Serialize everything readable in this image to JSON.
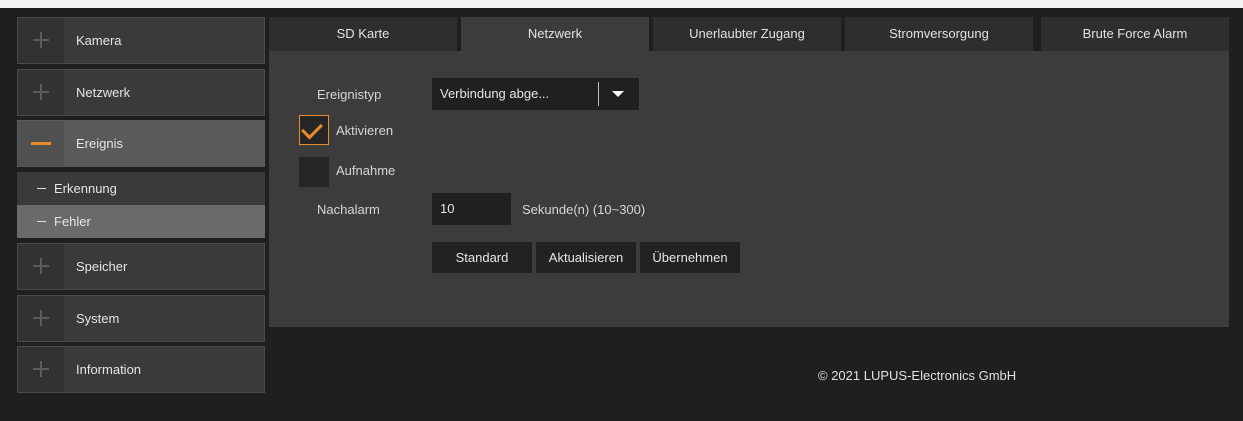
{
  "sidebar": {
    "items": [
      {
        "label": "Kamera",
        "icon": "plus-icon"
      },
      {
        "label": "Netzwerk",
        "icon": "plus-icon"
      },
      {
        "label": "Ereignis",
        "icon": "minus-icon",
        "expanded": true
      },
      {
        "label": "Speicher",
        "icon": "plus-icon"
      },
      {
        "label": "System",
        "icon": "plus-icon"
      },
      {
        "label": "Information",
        "icon": "plus-icon"
      }
    ],
    "subitems": [
      {
        "label": "Erkennung",
        "selected": false
      },
      {
        "label": "Fehler",
        "selected": true
      }
    ]
  },
  "tabs": [
    {
      "label": "SD Karte",
      "active": false
    },
    {
      "label": "Netzwerk",
      "active": true
    },
    {
      "label": "Unerlaubter Zugang",
      "active": false
    },
    {
      "label": "Stromversorgung",
      "active": false
    },
    {
      "label": "Brute Force Alarm",
      "active": false
    }
  ],
  "form": {
    "event_type_label": "Ereignistyp",
    "event_type_value": "Verbindung abge...",
    "enable_label": "Aktivieren",
    "enable_checked": true,
    "record_label": "Aufnahme",
    "record_checked": false,
    "post_alarm_label": "Nachalarm",
    "post_alarm_value": "10",
    "post_alarm_unit": "Sekunde(n) (10~300)"
  },
  "buttons": {
    "default_label": "Standard",
    "refresh_label": "Aktualisieren",
    "apply_label": "Übernehmen"
  },
  "footer": {
    "copyright": "© 2021 LUPUS-Electronics GmbH"
  },
  "colors": {
    "accent": "#e98b2a",
    "background": "#1f1f1f",
    "panel": "#3c3c3c"
  }
}
